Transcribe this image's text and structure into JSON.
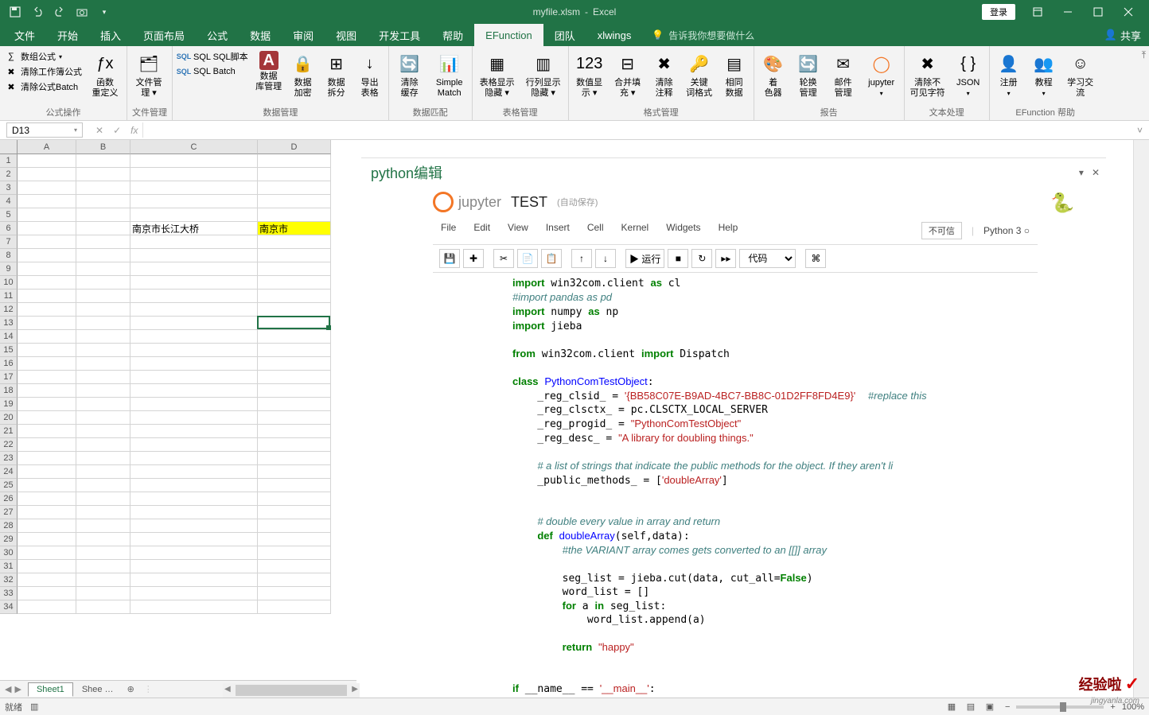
{
  "window": {
    "filename": "myfile.xlsm",
    "appname": "Excel",
    "login": "登录"
  },
  "qat": {
    "save": "▫",
    "undo": "↶",
    "redo": "↷",
    "camera": "📷",
    "more": "▾"
  },
  "tabs": {
    "file": "文件",
    "home": "开始",
    "insert": "插入",
    "page": "页面布局",
    "formula": "公式",
    "data": "数据",
    "review": "审阅",
    "view": "视图",
    "dev": "开发工具",
    "help": "帮助",
    "efunc": "EFunction",
    "team": "团队",
    "xlwings": "xlwings",
    "tell": "告诉我你想要做什么",
    "share": "共享"
  },
  "ribbon": {
    "g1": {
      "array": "数组公式",
      "clearbook": "清除工作簿公式",
      "clearbatch": "清除公式Batch",
      "label": "公式操作",
      "funcdef1": "函数",
      "funcdef2": "重定义"
    },
    "g2": {
      "filemgr1": "文件管",
      "filemgr2": "理",
      "label": "文件管理"
    },
    "g3": {
      "sql": "SQL SQL脚本",
      "batch": "SQL Batch",
      "access": "A",
      "db1": "数据",
      "db2": "库管理",
      "encrypt1": "数据",
      "encrypt2": "加密",
      "split1": "数据",
      "split2": "拆分",
      "export1": "导出",
      "export2": "表格",
      "label": "数据管理"
    },
    "g4": {
      "refresh1": "清除",
      "refresh2": "缓存",
      "match1": "Simple",
      "match2": "Match",
      "label": "数据匹配"
    },
    "g5": {
      "show1": "表格显示",
      "show2": "隐藏",
      "colshow1": "行列显示",
      "colshow2": "隐藏",
      "label": "表格管理"
    },
    "g6": {
      "numfmt1": "数值显",
      "numfmt2": "示",
      "merge1": "合并填",
      "merge2": "充",
      "clear1": "清除",
      "clear2": "注释",
      "key1": "关键",
      "key2": "词格式",
      "same1": "相同",
      "same2": "数据",
      "label": "格式管理"
    },
    "g7": {
      "color1": "着",
      "color2": "色器",
      "rotate1": "轮换",
      "rotate2": "管理",
      "mail1": "邮件",
      "mail2": "管理",
      "jupyter": "jupyter",
      "label": "报告"
    },
    "g8": {
      "clear1": "清除不",
      "clear2": "可见字符",
      "json": "JSON",
      "label": "文本处理"
    },
    "g9": {
      "reg1": "注册",
      "tutorial1": "教程",
      "study1": "学习交",
      "study2": "流",
      "label": "EFunction 帮助"
    }
  },
  "namebox": "D13",
  "sheet": {
    "cols": [
      "A",
      "B",
      "C",
      "D"
    ],
    "rows": 34,
    "c6": "南京市长江大桥",
    "d6": "南京市",
    "tab1": "Sheet1",
    "tab2": "Shee …",
    "add": "⊕",
    "status": "就绪"
  },
  "pypane": {
    "title": "python编辑"
  },
  "jup": {
    "brand": "jupyter",
    "title": "TEST",
    "auto": "(自动保存)",
    "menu": {
      "file": "File",
      "edit": "Edit",
      "view": "View",
      "insert": "Insert",
      "cell": "Cell",
      "kernel": "Kernel",
      "widgets": "Widgets",
      "help": "Help",
      "notrust": "不可信",
      "kernelname": "Python 3"
    },
    "tb": {
      "run": "▶ 运行",
      "stop": "■",
      "restart": "↻",
      "ff": "▸▸",
      "sel": "代码"
    }
  },
  "zoom": "100%"
}
